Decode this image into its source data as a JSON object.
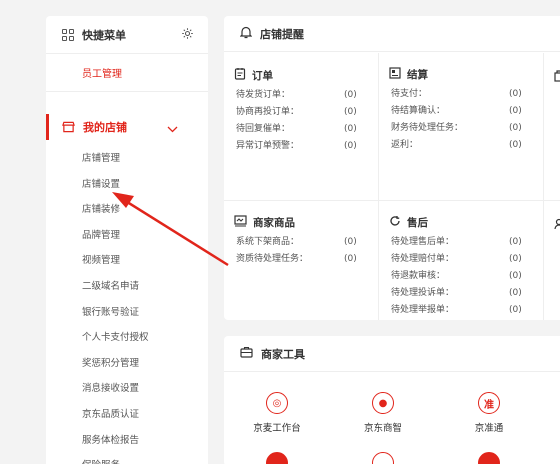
{
  "quick_menu": {
    "title": "快捷菜单",
    "staff_item": "员工管理"
  },
  "store": {
    "label": "我的店铺",
    "items": [
      "店铺管理",
      "店铺设置",
      "店铺装修",
      "品牌管理",
      "视频管理",
      "二级域名申请",
      "银行账号验证",
      "个人卡支付授权",
      "奖惩积分管理",
      "消息接收设置",
      "京东品质认证",
      "服务体检报告",
      "保险服务"
    ]
  },
  "remind": {
    "title": "店铺提醒",
    "orders": {
      "title": "订单",
      "rows": [
        {
          "k": "待发货订单：",
          "v": "(0)"
        },
        {
          "k": "协商再投订单：",
          "v": "(0)"
        },
        {
          "k": "待回复催单：",
          "v": "(0)"
        },
        {
          "k": "异常订单预警：",
          "v": "(0)"
        }
      ]
    },
    "settle": {
      "title": "结算",
      "rows": [
        {
          "k": "待支付：",
          "v": "(0)"
        },
        {
          "k": "待结算确认：",
          "v": "(0)"
        },
        {
          "k": "财务待处理任务：",
          "v": "(0)"
        },
        {
          "k": "返利：",
          "v": "(0)"
        }
      ]
    },
    "goods": {
      "title": "商家商品",
      "rows": [
        {
          "k": "系统下架商品：",
          "v": "(0)"
        },
        {
          "k": "资质待处理任务：",
          "v": "(0)"
        }
      ]
    },
    "after": {
      "title": "售后",
      "rows": [
        {
          "k": "待处理售后单：",
          "v": "(0)"
        },
        {
          "k": "待处理赔付单：",
          "v": "(0)"
        },
        {
          "k": "待退款审核：",
          "v": "(0)"
        },
        {
          "k": "待处理投诉单：",
          "v": "(0)"
        },
        {
          "k": "待处理举报单：",
          "v": "(0)"
        }
      ]
    }
  },
  "tools": {
    "title": "商家工具",
    "items": [
      {
        "label": "京麦工作台",
        "glyph": "◎"
      },
      {
        "label": "京东商智",
        "glyph": "●"
      },
      {
        "label": "京准通",
        "glyph": "准"
      }
    ]
  },
  "colors": {
    "accent": "#e1251b"
  }
}
